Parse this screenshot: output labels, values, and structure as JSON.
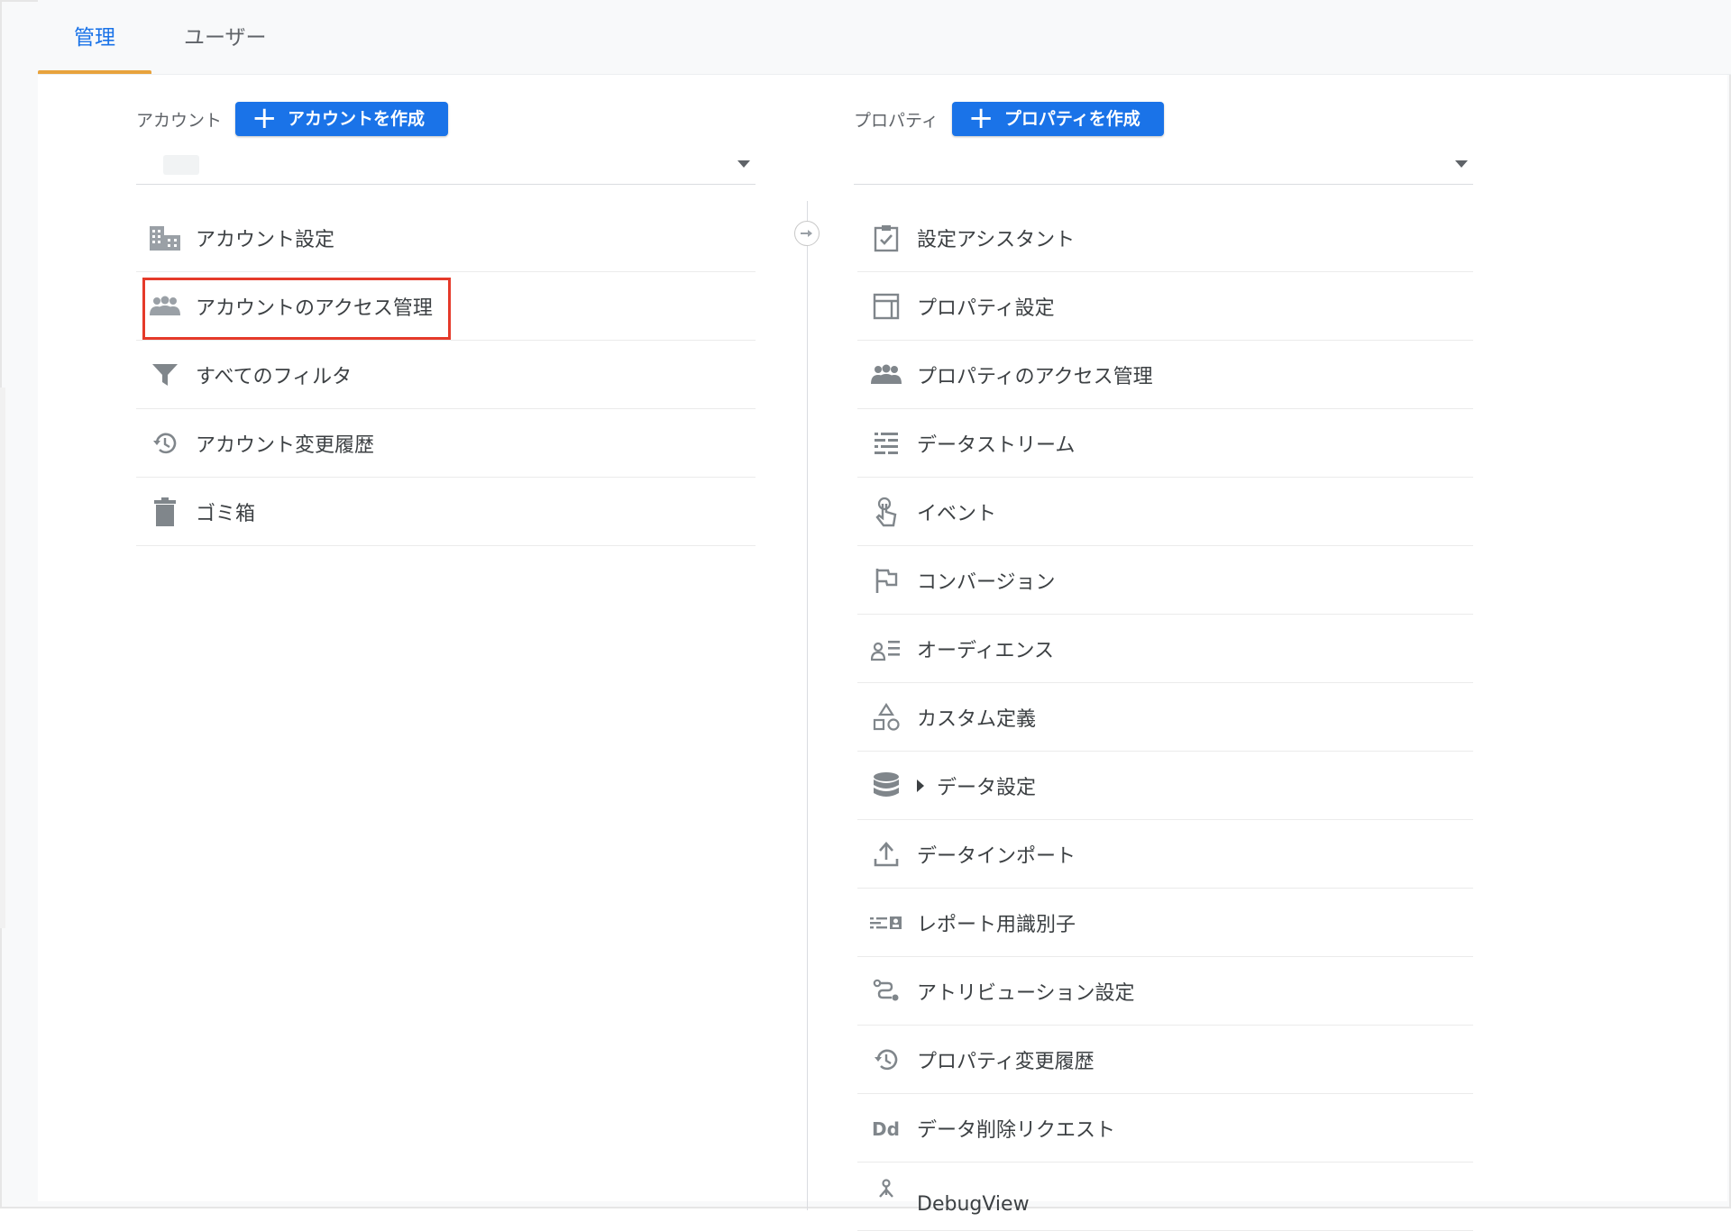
{
  "tabs": [
    {
      "label": "管理",
      "active": true
    },
    {
      "label": "ユーザー",
      "active": false
    }
  ],
  "account": {
    "label": "アカウント",
    "create_button": "アカウントを作成",
    "selected": "",
    "items": [
      {
        "label": "アカウント設定",
        "icon": "building-icon"
      },
      {
        "label": "アカウントのアクセス管理",
        "icon": "people-icon",
        "highlighted": true
      },
      {
        "label": "すべてのフィルタ",
        "icon": "filter-icon"
      },
      {
        "label": "アカウント変更履歴",
        "icon": "history-icon"
      },
      {
        "label": "ゴミ箱",
        "icon": "trash-icon"
      }
    ]
  },
  "property": {
    "label": "プロパティ",
    "create_button": "プロパティを作成",
    "selected": "",
    "items": [
      {
        "label": "設定アシスタント",
        "icon": "checklist-icon"
      },
      {
        "label": "プロパティ設定",
        "icon": "layout-icon"
      },
      {
        "label": "プロパティのアクセス管理",
        "icon": "people-icon"
      },
      {
        "label": "データストリーム",
        "icon": "stream-icon"
      },
      {
        "label": "イベント",
        "icon": "touch-icon"
      },
      {
        "label": "コンバージョン",
        "icon": "flag-icon"
      },
      {
        "label": "オーディエンス",
        "icon": "audience-icon"
      },
      {
        "label": "カスタム定義",
        "icon": "shapes-icon"
      },
      {
        "label": "データ設定",
        "icon": "database-icon",
        "expandable": true
      },
      {
        "label": "データインポート",
        "icon": "upload-icon"
      },
      {
        "label": "レポート用識別子",
        "icon": "identity-icon"
      },
      {
        "label": "アトリビューション設定",
        "icon": "attribution-icon"
      },
      {
        "label": "プロパティ変更履歴",
        "icon": "history-icon"
      },
      {
        "label": "データ削除リクエスト",
        "icon": "dd-icon"
      },
      {
        "label": "DebugView",
        "icon": "debug-icon"
      }
    ]
  },
  "colors": {
    "accent": "#1a73e8",
    "tab_underline": "#e8a33d",
    "highlight": "#e53a2a"
  }
}
